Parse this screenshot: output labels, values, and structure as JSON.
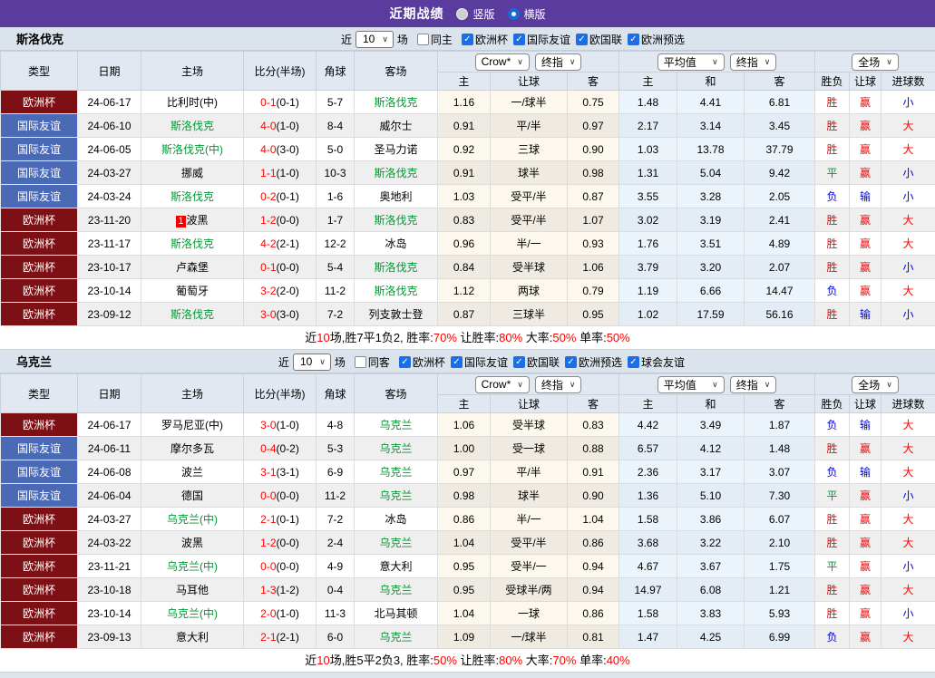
{
  "topbar": {
    "title": "近期战绩",
    "radio_vertical": "竖版",
    "radio_horizontal": "横版"
  },
  "colors": {
    "topbar_purple": "#5a3b9e",
    "cup_bg": "#7c1014",
    "friendly_bg": "#4b6ab6",
    "team_green": "#009933",
    "score_red": "#ff0000",
    "win_red": "#ff0000",
    "draw_green": "#009933",
    "lose_blue": "#0000dd",
    "checkbox_blue": "#1a6fe8"
  },
  "columns": [
    "类型",
    "日期",
    "主场",
    "比分(半场)",
    "角球",
    "客场"
  ],
  "sub_columns": [
    "主",
    "让球",
    "客",
    "主",
    "和",
    "客",
    "胜负",
    "让球",
    "进球数"
  ],
  "dropdowns": {
    "odds_source": "Crow*",
    "odds_period": "终指",
    "avg_source": "平均值",
    "avg_period": "终指",
    "scope": "全场"
  },
  "sections": [
    {
      "team": "斯洛伐克",
      "filter": {
        "near": "近",
        "count": "10",
        "games": "场",
        "same": "同主",
        "same_checked": false,
        "leagues": [
          "欧洲杯",
          "国际友谊",
          "欧国联",
          "欧洲预选"
        ]
      },
      "rows": [
        {
          "type": "欧洲杯",
          "tstyle": "cup",
          "date": "24-06-17",
          "home": "比利时(中)",
          "hg": false,
          "hbadge": "",
          "score": "0-1",
          "half": "(0-1)",
          "corner": "5-7",
          "away": "斯洛伐克",
          "ag": true,
          "o": [
            "1.16",
            "一/球半",
            "0.75"
          ],
          "avg": [
            "1.48",
            "4.41",
            "6.81"
          ],
          "res": [
            [
              "胜",
              "rw"
            ],
            [
              "赢",
              "rw"
            ],
            [
              "小",
              "rb"
            ]
          ]
        },
        {
          "type": "国际友谊",
          "tstyle": "fr",
          "date": "24-06-10",
          "home": "斯洛伐克",
          "hg": true,
          "hbadge": "",
          "score": "4-0",
          "half": "(1-0)",
          "corner": "8-4",
          "away": "威尔士",
          "ag": false,
          "o": [
            "0.91",
            "平/半",
            "0.97"
          ],
          "avg": [
            "2.17",
            "3.14",
            "3.45"
          ],
          "res": [
            [
              "胜",
              "rw"
            ],
            [
              "赢",
              "rw"
            ],
            [
              "大",
              "rw"
            ]
          ]
        },
        {
          "type": "国际友谊",
          "tstyle": "fr",
          "date": "24-06-05",
          "home": "斯洛伐克(中)",
          "hg": true,
          "hbadge": "",
          "score": "4-0",
          "half": "(3-0)",
          "corner": "5-0",
          "away": "圣马力诺",
          "ag": false,
          "o": [
            "0.92",
            "三球",
            "0.90"
          ],
          "avg": [
            "1.03",
            "13.78",
            "37.79"
          ],
          "res": [
            [
              "胜",
              "rw"
            ],
            [
              "赢",
              "rw"
            ],
            [
              "大",
              "rw"
            ]
          ]
        },
        {
          "type": "国际友谊",
          "tstyle": "fr",
          "date": "24-03-27",
          "home": "挪威",
          "hg": false,
          "hbadge": "",
          "score": "1-1",
          "half": "(1-0)",
          "corner": "10-3",
          "away": "斯洛伐克",
          "ag": true,
          "o": [
            "0.91",
            "球半",
            "0.98"
          ],
          "avg": [
            "1.31",
            "5.04",
            "9.42"
          ],
          "res": [
            [
              "平",
              "rg"
            ],
            [
              "赢",
              "rw"
            ],
            [
              "小",
              "rb"
            ]
          ]
        },
        {
          "type": "国际友谊",
          "tstyle": "fr",
          "date": "24-03-24",
          "home": "斯洛伐克",
          "hg": true,
          "hbadge": "",
          "score": "0-2",
          "half": "(0-1)",
          "corner": "1-6",
          "away": "奥地利",
          "ag": false,
          "o": [
            "1.03",
            "受平/半",
            "0.87"
          ],
          "avg": [
            "3.55",
            "3.28",
            "2.05"
          ],
          "res": [
            [
              "负",
              "rb"
            ],
            [
              "输",
              "rb"
            ],
            [
              "小",
              "rb"
            ]
          ]
        },
        {
          "type": "欧洲杯",
          "tstyle": "cup",
          "date": "23-11-20",
          "home": "波黑",
          "hg": false,
          "hbadge": "1",
          "score": "1-2",
          "half": "(0-0)",
          "corner": "1-7",
          "away": "斯洛伐克",
          "ag": true,
          "o": [
            "0.83",
            "受平/半",
            "1.07"
          ],
          "avg": [
            "3.02",
            "3.19",
            "2.41"
          ],
          "res": [
            [
              "胜",
              "rw"
            ],
            [
              "赢",
              "rw"
            ],
            [
              "大",
              "rw"
            ]
          ]
        },
        {
          "type": "欧洲杯",
          "tstyle": "cup",
          "date": "23-11-17",
          "home": "斯洛伐克",
          "hg": true,
          "hbadge": "",
          "score": "4-2",
          "half": "(2-1)",
          "corner": "12-2",
          "away": "冰岛",
          "ag": false,
          "o": [
            "0.96",
            "半/一",
            "0.93"
          ],
          "avg": [
            "1.76",
            "3.51",
            "4.89"
          ],
          "res": [
            [
              "胜",
              "rw"
            ],
            [
              "赢",
              "rw"
            ],
            [
              "大",
              "rw"
            ]
          ]
        },
        {
          "type": "欧洲杯",
          "tstyle": "cup",
          "date": "23-10-17",
          "home": "卢森堡",
          "hg": false,
          "hbadge": "",
          "score": "0-1",
          "half": "(0-0)",
          "corner": "5-4",
          "away": "斯洛伐克",
          "ag": true,
          "o": [
            "0.84",
            "受半球",
            "1.06"
          ],
          "avg": [
            "3.79",
            "3.20",
            "2.07"
          ],
          "res": [
            [
              "胜",
              "rw"
            ],
            [
              "赢",
              "rw"
            ],
            [
              "小",
              "rb"
            ]
          ]
        },
        {
          "type": "欧洲杯",
          "tstyle": "cup",
          "date": "23-10-14",
          "home": "葡萄牙",
          "hg": false,
          "hbadge": "",
          "score": "3-2",
          "half": "(2-0)",
          "corner": "11-2",
          "away": "斯洛伐克",
          "ag": true,
          "o": [
            "1.12",
            "两球",
            "0.79"
          ],
          "avg": [
            "1.19",
            "6.66",
            "14.47"
          ],
          "res": [
            [
              "负",
              "rb"
            ],
            [
              "赢",
              "rw"
            ],
            [
              "大",
              "rw"
            ]
          ]
        },
        {
          "type": "欧洲杯",
          "tstyle": "cup",
          "date": "23-09-12",
          "home": "斯洛伐克",
          "hg": true,
          "hbadge": "",
          "score": "3-0",
          "half": "(3-0)",
          "corner": "7-2",
          "away": "列支敦士登",
          "ag": false,
          "o": [
            "0.87",
            "三球半",
            "0.95"
          ],
          "avg": [
            "1.02",
            "17.59",
            "56.16"
          ],
          "res": [
            [
              "胜",
              "rw"
            ],
            [
              "输",
              "rb"
            ],
            [
              "小",
              "rb"
            ]
          ]
        }
      ],
      "summary": [
        {
          "t": "近",
          "r": 0
        },
        {
          "t": "10",
          "r": 1
        },
        {
          "t": "场,胜7平1负2, 胜率:",
          "r": 0
        },
        {
          "t": "70%",
          "r": 1
        },
        {
          "t": " 让胜率:",
          "r": 0
        },
        {
          "t": "80%",
          "r": 1
        },
        {
          "t": " 大率:",
          "r": 0
        },
        {
          "t": "50%",
          "r": 1
        },
        {
          "t": " 单率:",
          "r": 0
        },
        {
          "t": "50%",
          "r": 1
        }
      ]
    },
    {
      "team": "乌克兰",
      "filter": {
        "near": "近",
        "count": "10",
        "games": "场",
        "same": "同客",
        "same_checked": false,
        "leagues": [
          "欧洲杯",
          "国际友谊",
          "欧国联",
          "欧洲预选",
          "球会友谊"
        ]
      },
      "rows": [
        {
          "type": "欧洲杯",
          "tstyle": "cup",
          "date": "24-06-17",
          "home": "罗马尼亚(中)",
          "hg": false,
          "hbadge": "",
          "score": "3-0",
          "half": "(1-0)",
          "corner": "4-8",
          "away": "乌克兰",
          "ag": true,
          "o": [
            "1.06",
            "受半球",
            "0.83"
          ],
          "avg": [
            "4.42",
            "3.49",
            "1.87"
          ],
          "res": [
            [
              "负",
              "rb"
            ],
            [
              "输",
              "rb"
            ],
            [
              "大",
              "rw"
            ]
          ]
        },
        {
          "type": "国际友谊",
          "tstyle": "fr",
          "date": "24-06-11",
          "home": "摩尔多瓦",
          "hg": false,
          "hbadge": "",
          "score": "0-4",
          "half": "(0-2)",
          "corner": "5-3",
          "away": "乌克兰",
          "ag": true,
          "o": [
            "1.00",
            "受一球",
            "0.88"
          ],
          "avg": [
            "6.57",
            "4.12",
            "1.48"
          ],
          "res": [
            [
              "胜",
              "rw"
            ],
            [
              "赢",
              "rw"
            ],
            [
              "大",
              "rw"
            ]
          ]
        },
        {
          "type": "国际友谊",
          "tstyle": "fr",
          "date": "24-06-08",
          "home": "波兰",
          "hg": false,
          "hbadge": "",
          "score": "3-1",
          "half": "(3-1)",
          "corner": "6-9",
          "away": "乌克兰",
          "ag": true,
          "o": [
            "0.97",
            "平/半",
            "0.91"
          ],
          "avg": [
            "2.36",
            "3.17",
            "3.07"
          ],
          "res": [
            [
              "负",
              "rb"
            ],
            [
              "输",
              "rb"
            ],
            [
              "大",
              "rw"
            ]
          ]
        },
        {
          "type": "国际友谊",
          "tstyle": "fr",
          "date": "24-06-04",
          "home": "德国",
          "hg": false,
          "hbadge": "",
          "score": "0-0",
          "half": "(0-0)",
          "corner": "11-2",
          "away": "乌克兰",
          "ag": true,
          "o": [
            "0.98",
            "球半",
            "0.90"
          ],
          "avg": [
            "1.36",
            "5.10",
            "7.30"
          ],
          "res": [
            [
              "平",
              "rg"
            ],
            [
              "赢",
              "rw"
            ],
            [
              "小",
              "rb"
            ]
          ]
        },
        {
          "type": "欧洲杯",
          "tstyle": "cup",
          "date": "24-03-27",
          "home": "乌克兰(中)",
          "hg": true,
          "hbadge": "",
          "score": "2-1",
          "half": "(0-1)",
          "corner": "7-2",
          "away": "冰岛",
          "ag": false,
          "o": [
            "0.86",
            "半/一",
            "1.04"
          ],
          "avg": [
            "1.58",
            "3.86",
            "6.07"
          ],
          "res": [
            [
              "胜",
              "rw"
            ],
            [
              "赢",
              "rw"
            ],
            [
              "大",
              "rw"
            ]
          ]
        },
        {
          "type": "欧洲杯",
          "tstyle": "cup",
          "date": "24-03-22",
          "home": "波黑",
          "hg": false,
          "hbadge": "",
          "score": "1-2",
          "half": "(0-0)",
          "corner": "2-4",
          "away": "乌克兰",
          "ag": true,
          "o": [
            "1.04",
            "受平/半",
            "0.86"
          ],
          "avg": [
            "3.68",
            "3.22",
            "2.10"
          ],
          "res": [
            [
              "胜",
              "rw"
            ],
            [
              "赢",
              "rw"
            ],
            [
              "大",
              "rw"
            ]
          ]
        },
        {
          "type": "欧洲杯",
          "tstyle": "cup",
          "date": "23-11-21",
          "home": "乌克兰(中)",
          "hg": true,
          "hbadge": "",
          "score": "0-0",
          "half": "(0-0)",
          "corner": "4-9",
          "away": "意大利",
          "ag": false,
          "o": [
            "0.95",
            "受半/一",
            "0.94"
          ],
          "avg": [
            "4.67",
            "3.67",
            "1.75"
          ],
          "res": [
            [
              "平",
              "rg"
            ],
            [
              "赢",
              "rw"
            ],
            [
              "小",
              "rb"
            ]
          ]
        },
        {
          "type": "欧洲杯",
          "tstyle": "cup",
          "date": "23-10-18",
          "home": "马耳他",
          "hg": false,
          "hbadge": "",
          "score": "1-3",
          "half": "(1-2)",
          "corner": "0-4",
          "away": "乌克兰",
          "ag": true,
          "o": [
            "0.95",
            "受球半/两",
            "0.94"
          ],
          "avg": [
            "14.97",
            "6.08",
            "1.21"
          ],
          "res": [
            [
              "胜",
              "rw"
            ],
            [
              "赢",
              "rw"
            ],
            [
              "大",
              "rw"
            ]
          ]
        },
        {
          "type": "欧洲杯",
          "tstyle": "cup",
          "date": "23-10-14",
          "home": "乌克兰(中)",
          "hg": true,
          "hbadge": "",
          "score": "2-0",
          "half": "(1-0)",
          "corner": "11-3",
          "away": "北马其顿",
          "ag": false,
          "o": [
            "1.04",
            "一球",
            "0.86"
          ],
          "avg": [
            "1.58",
            "3.83",
            "5.93"
          ],
          "res": [
            [
              "胜",
              "rw"
            ],
            [
              "赢",
              "rw"
            ],
            [
              "小",
              "rb"
            ]
          ]
        },
        {
          "type": "欧洲杯",
          "tstyle": "cup",
          "date": "23-09-13",
          "home": "意大利",
          "hg": false,
          "hbadge": "",
          "score": "2-1",
          "half": "(2-1)",
          "corner": "6-0",
          "away": "乌克兰",
          "ag": true,
          "o": [
            "1.09",
            "一/球半",
            "0.81"
          ],
          "avg": [
            "1.47",
            "4.25",
            "6.99"
          ],
          "res": [
            [
              "负",
              "rb"
            ],
            [
              "赢",
              "rw"
            ],
            [
              "大",
              "rw"
            ]
          ]
        }
      ],
      "summary": [
        {
          "t": "近",
          "r": 0
        },
        {
          "t": "10",
          "r": 1
        },
        {
          "t": "场,胜5平2负3, 胜率:",
          "r": 0
        },
        {
          "t": "50%",
          "r": 1
        },
        {
          "t": " 让胜率:",
          "r": 0
        },
        {
          "t": "80%",
          "r": 1
        },
        {
          "t": " 大率:",
          "r": 0
        },
        {
          "t": "70%",
          "r": 1
        },
        {
          "t": " 单率:",
          "r": 0
        },
        {
          "t": "40%",
          "r": 1
        }
      ]
    }
  ]
}
